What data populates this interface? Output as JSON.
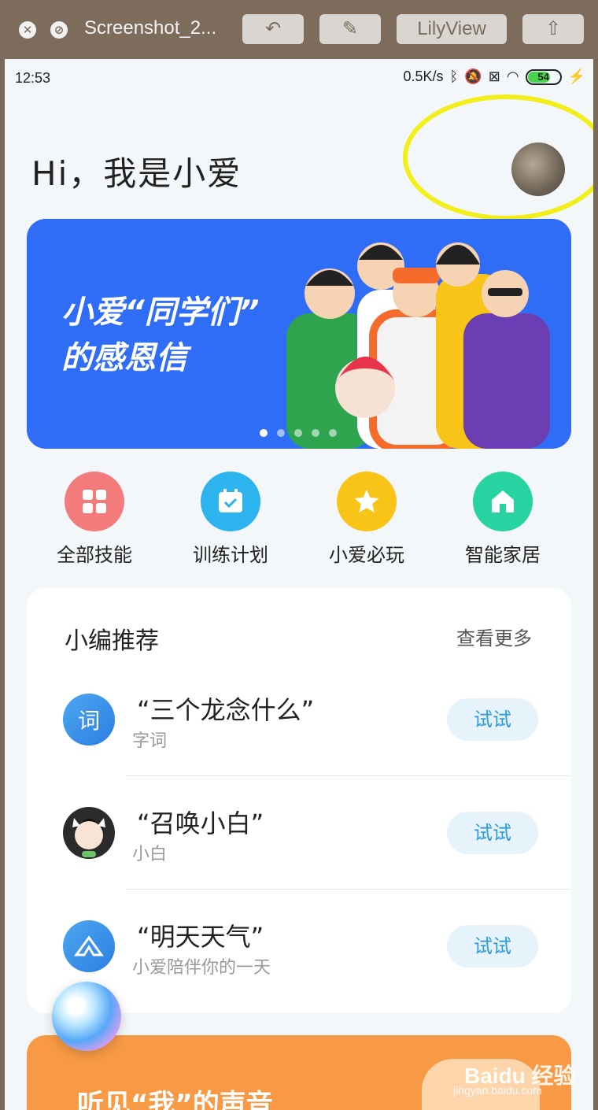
{
  "toolbar": {
    "title": "Screenshot_2...",
    "lilyview_label": "LilyView",
    "close_icon": "close-icon",
    "minimize_icon": "minimize-icon",
    "rotate_icon": "rotate-icon",
    "markup_icon": "markup-pen-icon",
    "share_icon": "share-icon"
  },
  "status_bar": {
    "time": "12:53",
    "net_speed": "0.5K/s",
    "battery": "54"
  },
  "header": {
    "greeting": "Hi，我是小爱"
  },
  "banner": {
    "title": "小爱“同学们”\n的感恩信",
    "dots_count": 5,
    "active_dot": 0,
    "bg_color": "#2f6df6"
  },
  "quick_actions": [
    {
      "label": "全部技能",
      "icon": "grid-icon",
      "color": "#f47b7b"
    },
    {
      "label": "训练计划",
      "icon": "calendar-check-icon",
      "color": "#2db3ee"
    },
    {
      "label": "小爱必玩",
      "icon": "star-icon",
      "color": "#f9c418"
    },
    {
      "label": "智能家居",
      "icon": "home-icon",
      "color": "#27d3a1"
    }
  ],
  "recommend": {
    "title": "小编推荐",
    "more_label": "查看更多",
    "try_label": "试试",
    "items": [
      {
        "title": "“三个龙念什么”",
        "subtitle": "字词",
        "icon_text": "词"
      },
      {
        "title": "“召唤小白”",
        "subtitle": "小白",
        "icon_text": ""
      },
      {
        "title": "“明天天气”",
        "subtitle": "小爱陪伴你的一天",
        "icon_text": ""
      }
    ]
  },
  "bottom_card": {
    "text": "听见“我”的声音"
  },
  "watermark": {
    "main": "Baidu 经验",
    "sub": "jingyan.baidu.com"
  }
}
